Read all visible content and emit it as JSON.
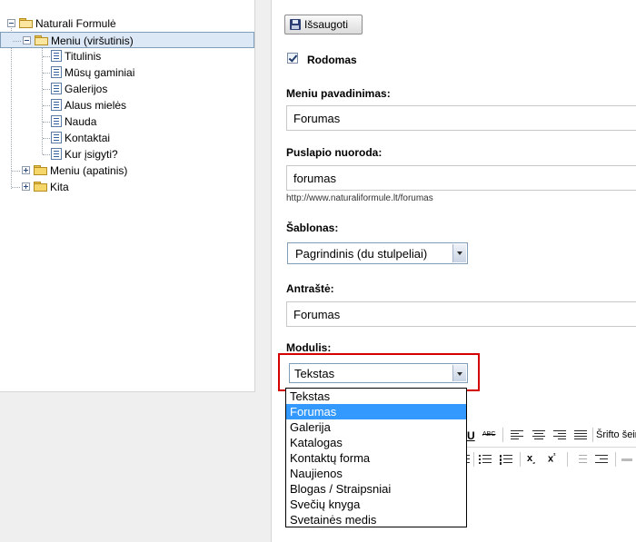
{
  "tree": {
    "root": "Naturali Formulė",
    "top_menu": "Meniu (viršutinis)",
    "top_items": [
      "Titulinis",
      "Mūsų gaminiai",
      "Galerijos",
      "Alaus mielės",
      "Nauda",
      "Kontaktai",
      "Kur įsigyti?"
    ],
    "bottom_menu": "Meniu (apatinis)",
    "other": "Kita"
  },
  "form": {
    "save_label": "Išsaugoti",
    "shown_label": "Rodomas",
    "shown_checked": true,
    "menu_name_label": "Meniu pavadinimas:",
    "menu_name_value": "Forumas",
    "page_link_label": "Puslapio nuoroda:",
    "page_link_value": "forumas",
    "page_url": "http://www.naturaliformule.lt/forumas",
    "template_label": "Šablonas:",
    "template_value": "Pagrindinis (du stulpeliai)",
    "heading_label": "Antraštė:",
    "heading_value": "Forumas",
    "module_label": "Modulis:",
    "module_value": "Tekstas"
  },
  "module_options": [
    "Tekstas",
    "Forumas",
    "Galerija",
    "Katalogas",
    "Kontaktų forma",
    "Naujienos",
    "Blogas / Straipsniai",
    "Svečių knyga",
    "Svetainės medis"
  ],
  "module_highlighted": "Forumas",
  "editor_toolbar": {
    "underline": "U",
    "strike": "ABC",
    "font_size_label": "Šrifto šeir"
  },
  "colors": {
    "selected_row": "#dde8f6",
    "highlight": "#3399ff",
    "red_outline": "#d40000"
  }
}
